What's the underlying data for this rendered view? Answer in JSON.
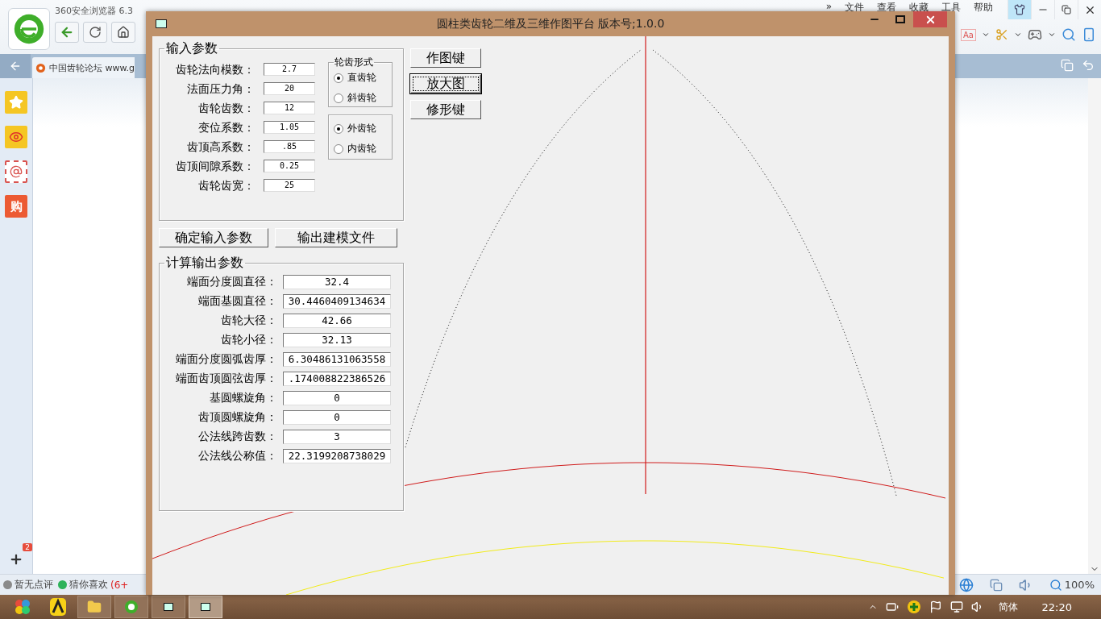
{
  "browser": {
    "title": "360安全浏览器 6.3",
    "menu": [
      "»",
      "文件",
      "查看",
      "收藏",
      "工具",
      "帮助"
    ],
    "font_label": "Aa",
    "tab": {
      "title": "中国齿轮论坛 www.g"
    },
    "shop_glyph": "购",
    "sidebar_badge": "2",
    "status_left": [
      {
        "kind": "rating",
        "text": "暂无点评"
      },
      {
        "kind": "guess",
        "text": "猜你喜欢",
        "extra": "(6+"
      }
    ],
    "zoom": "100%"
  },
  "app_window": {
    "title": "圆柱类齿轮二维及三维作图平台 版本号;1.0.0",
    "input_group": {
      "title": "输入参数",
      "fields": [
        {
          "label": "齿轮法向模数：",
          "value": "2.7"
        },
        {
          "label": "法面压力角：",
          "value": "20"
        },
        {
          "label": "齿轮齿数：",
          "value": "12"
        },
        {
          "label": "变位系数：",
          "value": "1.05"
        },
        {
          "label": "齿顶高系数：",
          "value": ".85"
        },
        {
          "label": "齿顶间隙系数：",
          "value": "0.25"
        },
        {
          "label": "齿轮齿宽：",
          "value": "25"
        }
      ]
    },
    "tooth_form": {
      "title": "轮齿形式",
      "options": [
        {
          "label": "直齿轮",
          "selected": true
        },
        {
          "label": "斜齿轮",
          "selected": false
        }
      ]
    },
    "gear_type": {
      "options": [
        {
          "label": "外齿轮",
          "selected": true
        },
        {
          "label": "内齿轮",
          "selected": false
        }
      ]
    },
    "side_buttons": [
      {
        "label": "作图键",
        "focused": false
      },
      {
        "label": "放大图",
        "focused": true
      },
      {
        "label": "修形键",
        "focused": false
      }
    ],
    "action_buttons": [
      "确定输入参数",
      "输出建模文件"
    ],
    "output_group": {
      "title": "计算输出参数",
      "fields": [
        {
          "label": "端面分度圆直径：",
          "value": "32.4"
        },
        {
          "label": "端面基圆直径：",
          "value": "30.4460409134634"
        },
        {
          "label": "齿轮大径：",
          "value": "42.66"
        },
        {
          "label": "齿轮小径：",
          "value": "32.13"
        },
        {
          "label": "端面分度圆弧齿厚：",
          "value": "6.30486131063558"
        },
        {
          "label": "端面齿顶圆弦齿厚：",
          "value": ".174008822386526"
        },
        {
          "label": "基圆螺旋角：",
          "value": "0"
        },
        {
          "label": "齿顶圆螺旋角：",
          "value": "0"
        },
        {
          "label": "公法线跨齿数：",
          "value": "3"
        },
        {
          "label": "公法线公称值：",
          "value": "22.3199208738029"
        }
      ]
    }
  },
  "taskbar": {
    "language": "简体",
    "clock": "22:20"
  }
}
